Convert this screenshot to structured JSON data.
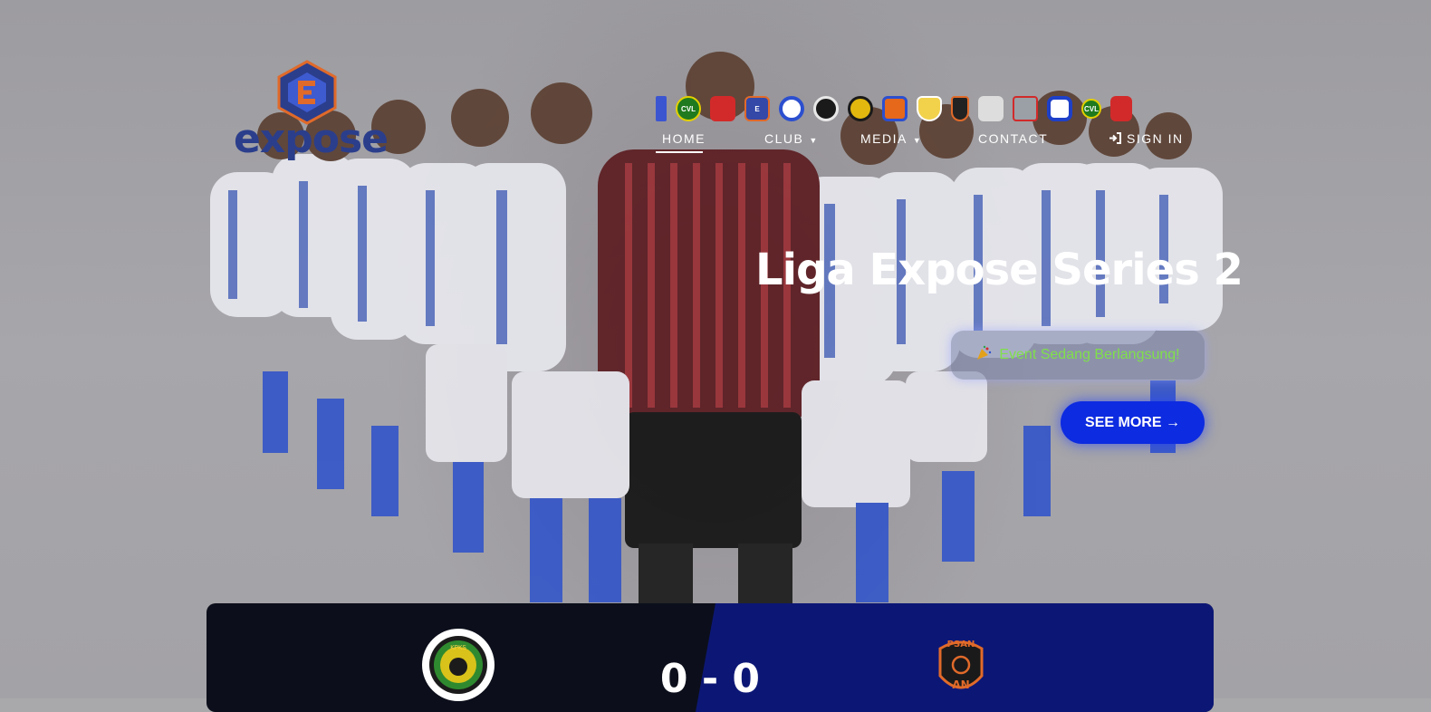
{
  "brand": {
    "name": "expose"
  },
  "nav": {
    "home": "HOME",
    "club": "CLUB",
    "media": "MEDIA",
    "contact": "CONTACT",
    "sign_in": "SIGN IN"
  },
  "club_badges": [
    {
      "icon": "club-badge-partial",
      "color": "#3b55d1"
    },
    {
      "icon": "club-badge-cvl",
      "color": "#1f7a1f",
      "label": "CVL"
    },
    {
      "icon": "club-badge-red",
      "color": "#d22a2a"
    },
    {
      "icon": "club-badge-expose",
      "color": "#3448a8"
    },
    {
      "icon": "club-badge-blue-ring",
      "color": "#2c4fcf"
    },
    {
      "icon": "club-badge-black-gold",
      "color": "#1a1a1a"
    },
    {
      "icon": "club-badge-yellow-black",
      "color": "#e2b80f"
    },
    {
      "icon": "club-badge-orange-blue",
      "color": "#e5681b"
    },
    {
      "icon": "club-badge-yellow-shield",
      "color": "#f2d24b"
    },
    {
      "icon": "club-badge-psan",
      "color": "#222222"
    },
    {
      "icon": "club-badge-white",
      "color": "#dddddd"
    },
    {
      "icon": "club-badge-grey",
      "color": "#9aa0a6"
    },
    {
      "icon": "club-badge-blue-white",
      "color": "#1e40c8"
    },
    {
      "icon": "club-badge-cvl-2",
      "color": "#1f7a1f",
      "label": "CVL"
    },
    {
      "icon": "club-badge-red-2",
      "color": "#d22a2a"
    }
  ],
  "hero": {
    "title": "Liga Expose Series 2",
    "event_status": "Event Sedang Berlangsung!",
    "event_icon": "party-popper-icon",
    "see_more": "SEE MORE →"
  },
  "match": {
    "home_team_icon": "team-logo-kpks",
    "away_team_icon": "team-logo-psan",
    "score": "0 - 0"
  },
  "colors": {
    "accent": "#0d2be0",
    "event_text": "#7fe04a",
    "match_dark": "#0c0f1b",
    "match_blue": "#0c1775"
  }
}
